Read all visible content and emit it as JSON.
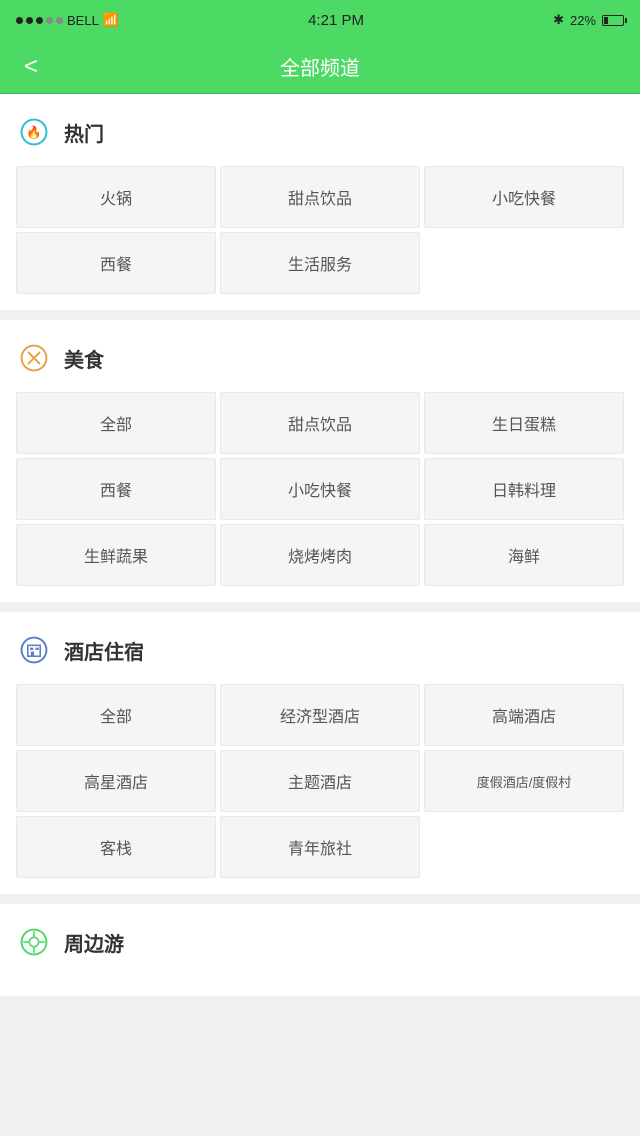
{
  "statusBar": {
    "carrier": "BELL",
    "time": "4:21 PM",
    "battery": "22%",
    "signal_filled": 3,
    "signal_empty": 2
  },
  "navBar": {
    "back_label": "<",
    "title": "全部频道"
  },
  "sections": [
    {
      "id": "hot",
      "icon": "hot-icon",
      "title": "热门",
      "items": [
        [
          "火锅",
          "甜点饮品",
          "小吃快餐"
        ],
        [
          "西餐",
          "生活服务",
          ""
        ]
      ]
    },
    {
      "id": "food",
      "icon": "food-icon",
      "title": "美食",
      "items": [
        [
          "全部",
          "甜点饮品",
          "生日蛋糕"
        ],
        [
          "西餐",
          "小吃快餐",
          "日韩料理"
        ],
        [
          "生鲜蔬果",
          "烧烤烤肉",
          "海鲜"
        ]
      ]
    },
    {
      "id": "hotel",
      "icon": "hotel-icon",
      "title": "酒店住宿",
      "items": [
        [
          "全部",
          "经济型酒店",
          "高端酒店"
        ],
        [
          "高星酒店",
          "主题酒店",
          "度假酒店/度假村"
        ],
        [
          "客栈",
          "青年旅社",
          ""
        ]
      ]
    },
    {
      "id": "travel",
      "icon": "travel-icon",
      "title": "周边游",
      "items": []
    }
  ]
}
